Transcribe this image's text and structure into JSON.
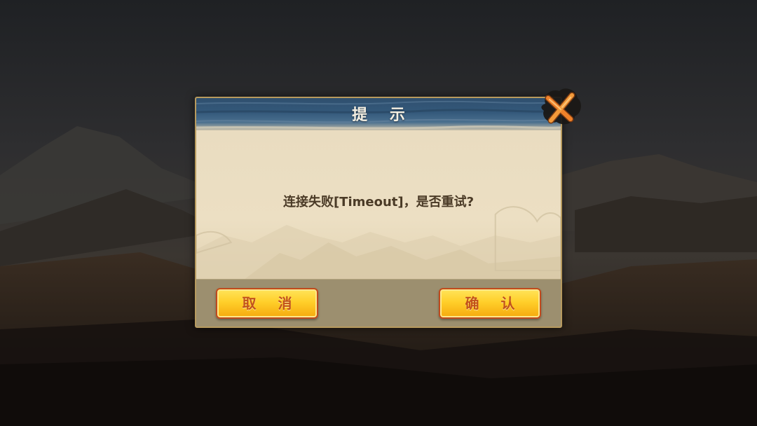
{
  "dialog": {
    "title": "提 示",
    "message": "连接失败[Timeout]，是否重试?",
    "cancel_label": "取 消",
    "confirm_label": "确 认"
  },
  "icons": {
    "close": "close-x-icon"
  },
  "colors": {
    "header_blue": "#34597b",
    "parchment": "#e9dcc0",
    "button_gold": "#ffcf2a",
    "button_border": "#c04a1c",
    "close_orange": "#f0822a"
  }
}
